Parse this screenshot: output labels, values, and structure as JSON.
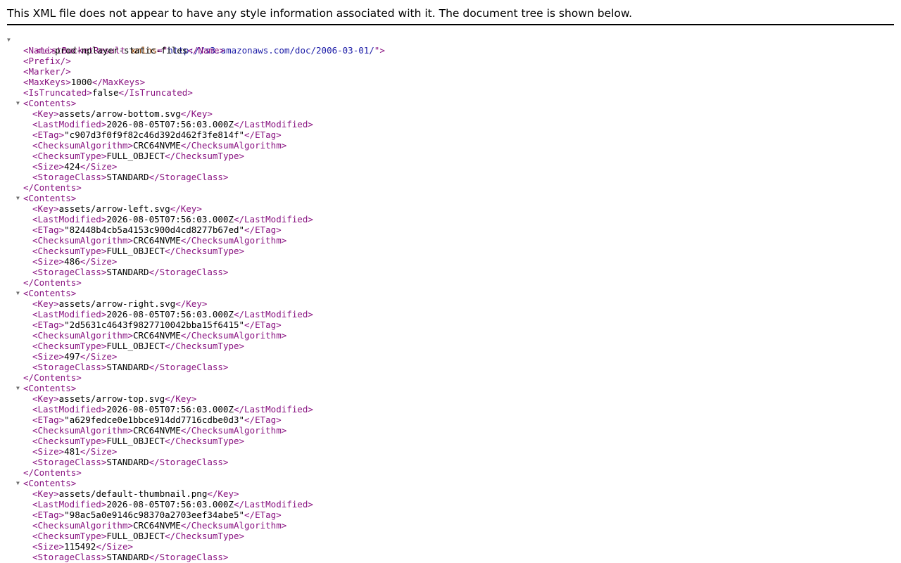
{
  "header": {
    "notice": "This XML file does not appear to have any style information associated with it. The document tree is shown below."
  },
  "colors": {
    "tag": "#881280",
    "attribute": "#994500",
    "attribute_value": "#1a1aa6",
    "text": "#000000",
    "toggle": "#6e6e6e"
  },
  "icons": {
    "toggle_expanded": "▼"
  },
  "root": {
    "tag": "ListBucketResult",
    "attr_name": "xmlns",
    "attr_value": "http://s3.amazonaws.com/doc/2006-03-01/"
  },
  "bucket": {
    "name": "prod-nplayer-static-files",
    "max_keys": "1000",
    "is_truncated": "false"
  },
  "contents": [
    {
      "key": "assets/arrow-bottom.svg",
      "last_modified": "2026-08-05T07:56:03.000Z",
      "etag": "\"c907d3f0f9f82c46d392d462f3fe814f\"",
      "checksum_algorithm": "CRC64NVME",
      "checksum_type": "FULL_OBJECT",
      "size": "424",
      "storage_class": "STANDARD"
    },
    {
      "key": "assets/arrow-left.svg",
      "last_modified": "2026-08-05T07:56:03.000Z",
      "etag": "\"82448b4cb5a4153c900d4cd8277b67ed\"",
      "checksum_algorithm": "CRC64NVME",
      "checksum_type": "FULL_OBJECT",
      "size": "486",
      "storage_class": "STANDARD"
    },
    {
      "key": "assets/arrow-right.svg",
      "last_modified": "2026-08-05T07:56:03.000Z",
      "etag": "\"2d5631c4643f9827710042bba15f6415\"",
      "checksum_algorithm": "CRC64NVME",
      "checksum_type": "FULL_OBJECT",
      "size": "497",
      "storage_class": "STANDARD"
    },
    {
      "key": "assets/arrow-top.svg",
      "last_modified": "2026-08-05T07:56:03.000Z",
      "etag": "\"a629fedce0e1bbce914dd7716cdbe0d3\"",
      "checksum_algorithm": "CRC64NVME",
      "checksum_type": "FULL_OBJECT",
      "size": "481",
      "storage_class": "STANDARD"
    },
    {
      "key": "assets/default-thumbnail.png",
      "last_modified": "2026-08-05T07:56:03.000Z",
      "etag": "\"98ac5a0e9146c98370a2703eef34abe5\"",
      "checksum_algorithm": "CRC64NVME",
      "checksum_type": "FULL_OBJECT",
      "size": "115492",
      "storage_class": "STANDARD"
    }
  ]
}
